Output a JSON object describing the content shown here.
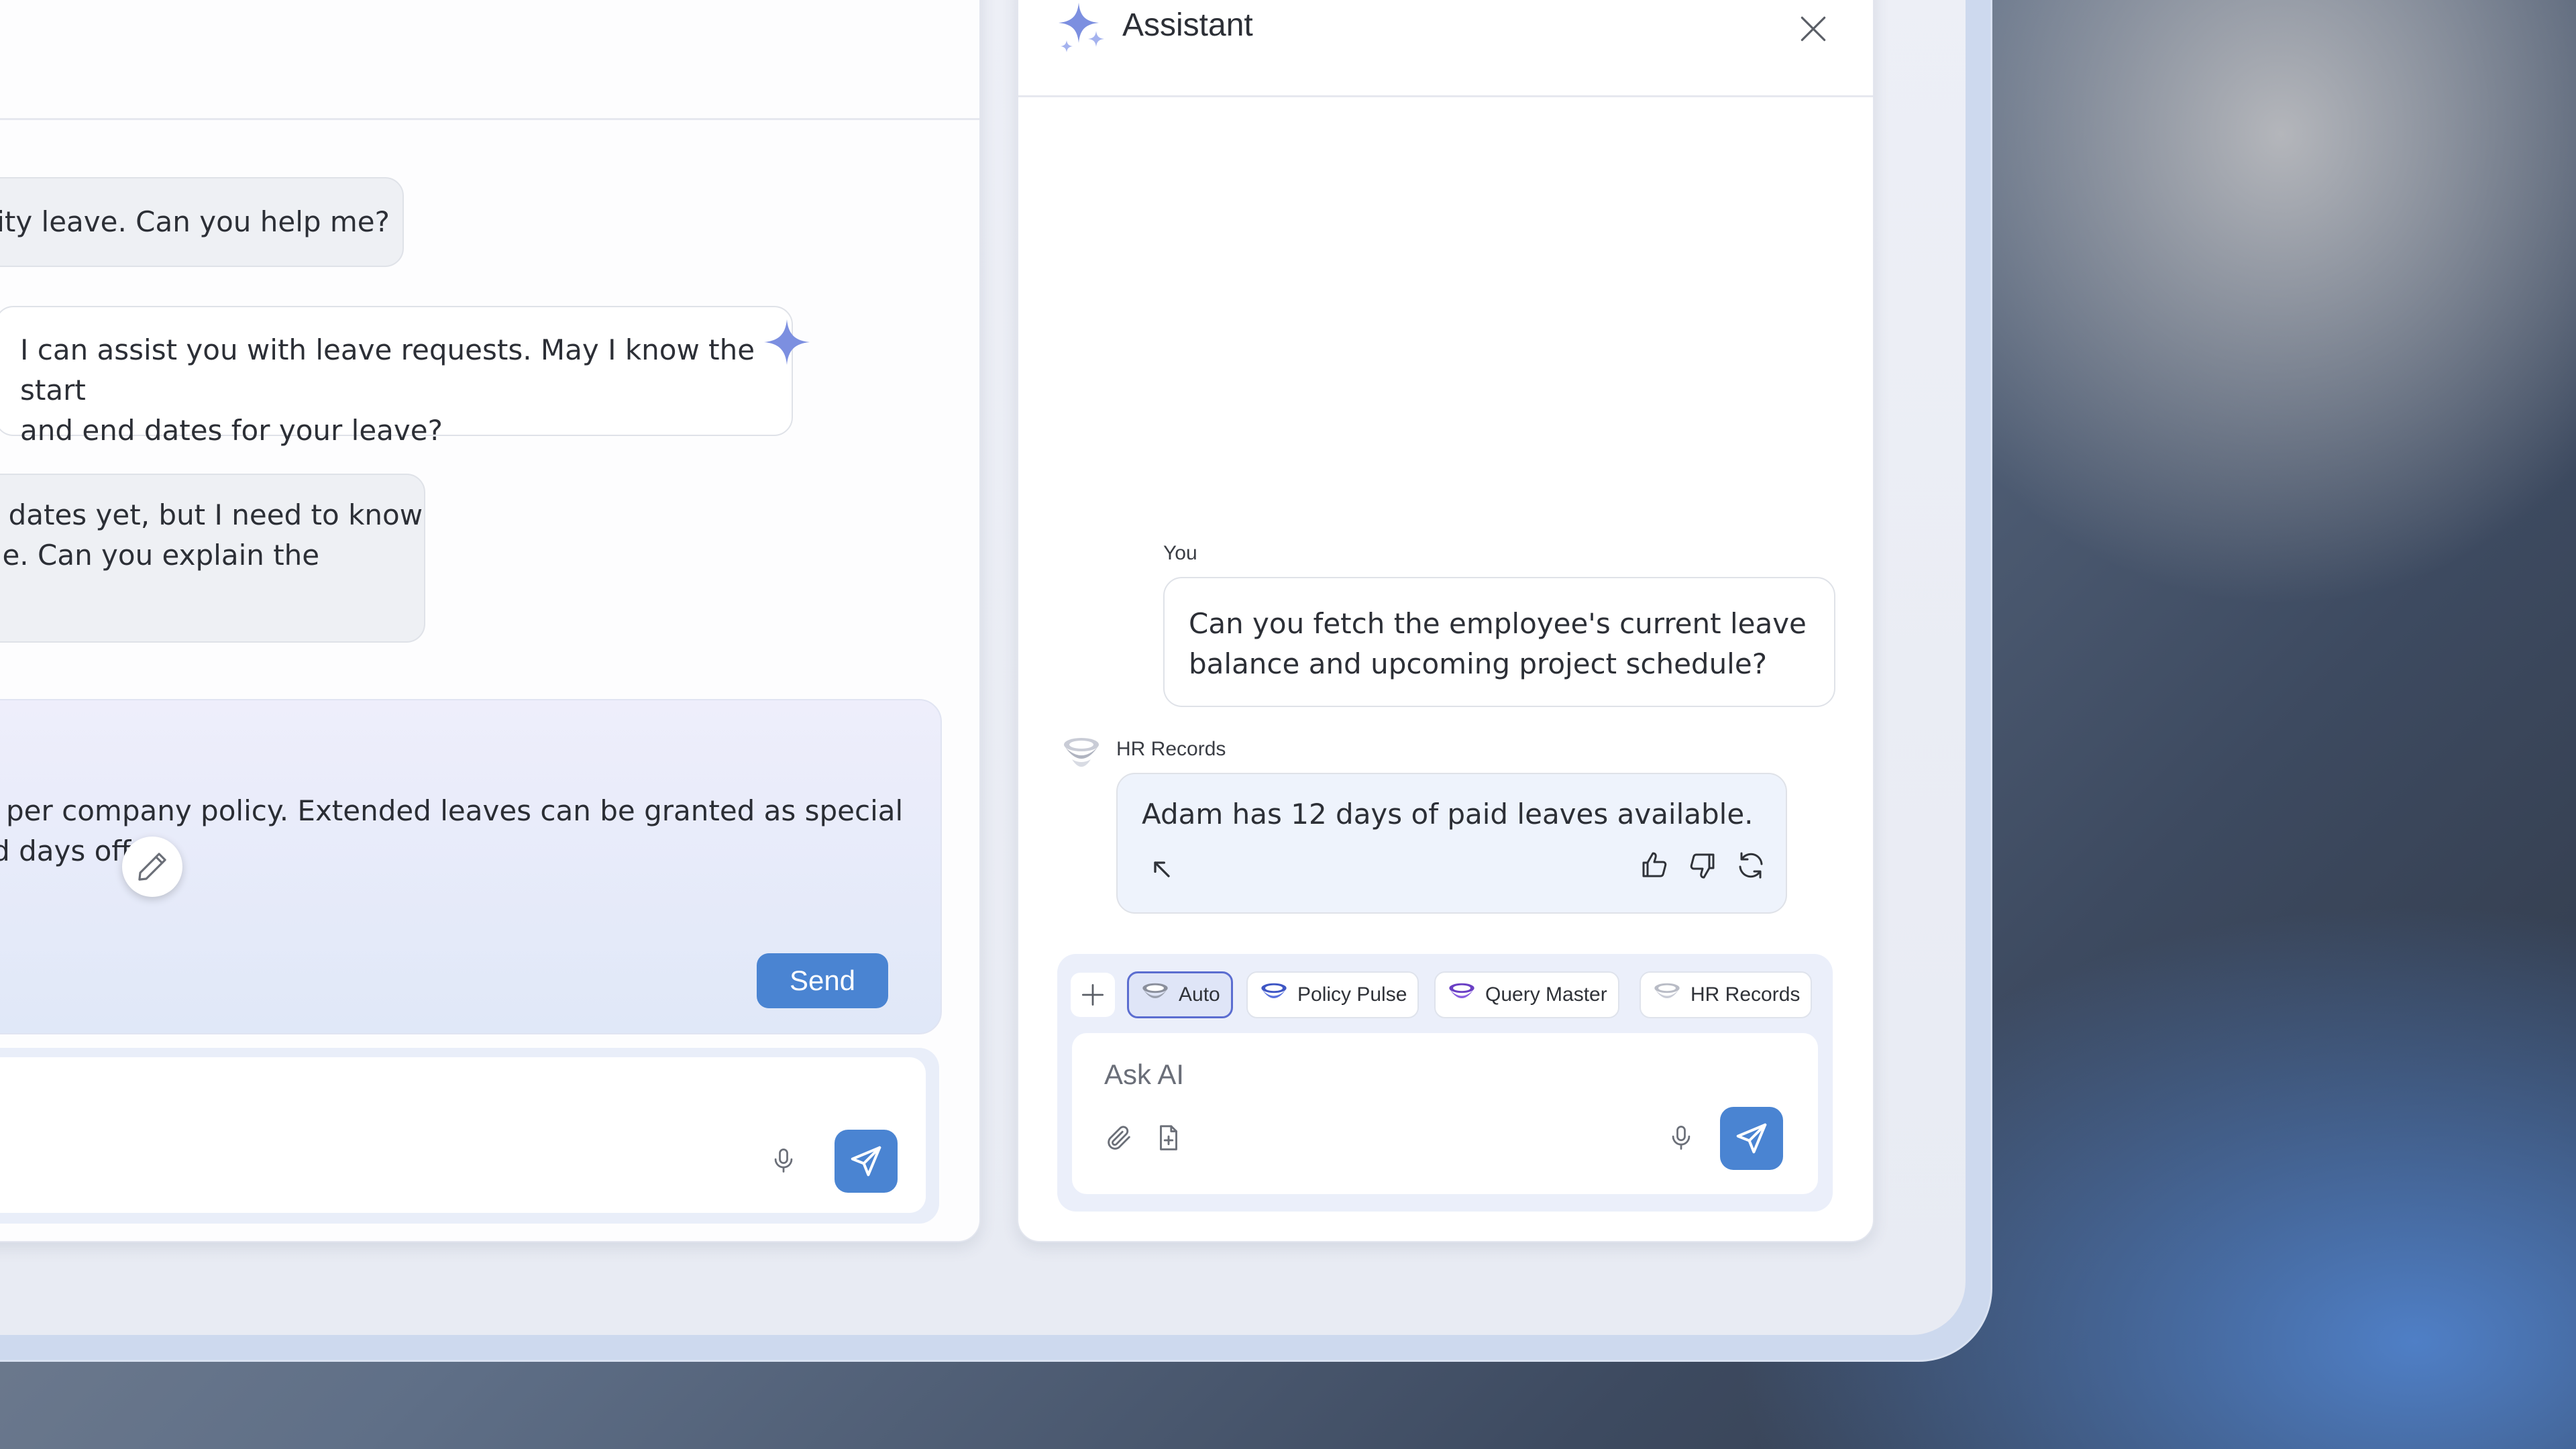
{
  "left_chat": {
    "messages": [
      {
        "role": "user",
        "text": "aternity leave. Can you help me?"
      },
      {
        "role": "assistant",
        "text_line1": "I can assist you with leave requests. May I know the start",
        "text_line2": "and end dates for your leave?"
      },
      {
        "role": "user",
        "text_line1": "exact dates yet, but I need to know",
        "text_line2": "ossible. Can you explain the"
      }
    ],
    "compose": {
      "line1": "ve as per company policy. Extended leaves can be granted as special",
      "line2": "g paid days off.",
      "send_label": "Send"
    }
  },
  "assistant_panel": {
    "title": "Assistant",
    "you_label": "You",
    "user_message_line1": "Can you fetch the employee's current leave",
    "user_message_line2": "balance and upcoming project schedule?",
    "responder_label": "HR Records",
    "response_text": "Adam has 12 days of paid leaves available.",
    "chips": [
      {
        "label": "Auto",
        "active": true
      },
      {
        "label": "Policy Pulse",
        "active": false
      },
      {
        "label": "Query Master",
        "active": false
      },
      {
        "label": "HR Records",
        "active": false
      }
    ],
    "input_placeholder": "Ask AI"
  },
  "colors": {
    "accent": "#4a84d2",
    "active_chip_border": "#5b6dd0",
    "sparkle": "#7c8fe0"
  }
}
